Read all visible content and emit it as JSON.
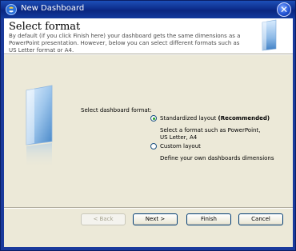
{
  "window": {
    "title": "New Dashboard"
  },
  "header": {
    "title": "Select format",
    "description": "By default (if you click Finish here) your dashboard gets the same dimensions as a PowerPoint presentation. However, below you can select different formats such as US Letter format or A4."
  },
  "form": {
    "label": "Select dashboard format:",
    "options": [
      {
        "label": "Standardized layout",
        "emphasis": "(Recommended)",
        "description": "Select a format such as PowerPoint, US Letter, A4",
        "selected": true
      },
      {
        "label": "Custom layout",
        "description": "Define your own dashboards dimensions",
        "selected": false
      }
    ]
  },
  "buttons": {
    "back": "< Back",
    "next": "Next >",
    "finish": "Finish",
    "cancel": "Cancel"
  },
  "colors": {
    "titlebar": "#0e2f8e",
    "dialog_bg": "#ece9d8",
    "radio_selected": "#21a121"
  }
}
